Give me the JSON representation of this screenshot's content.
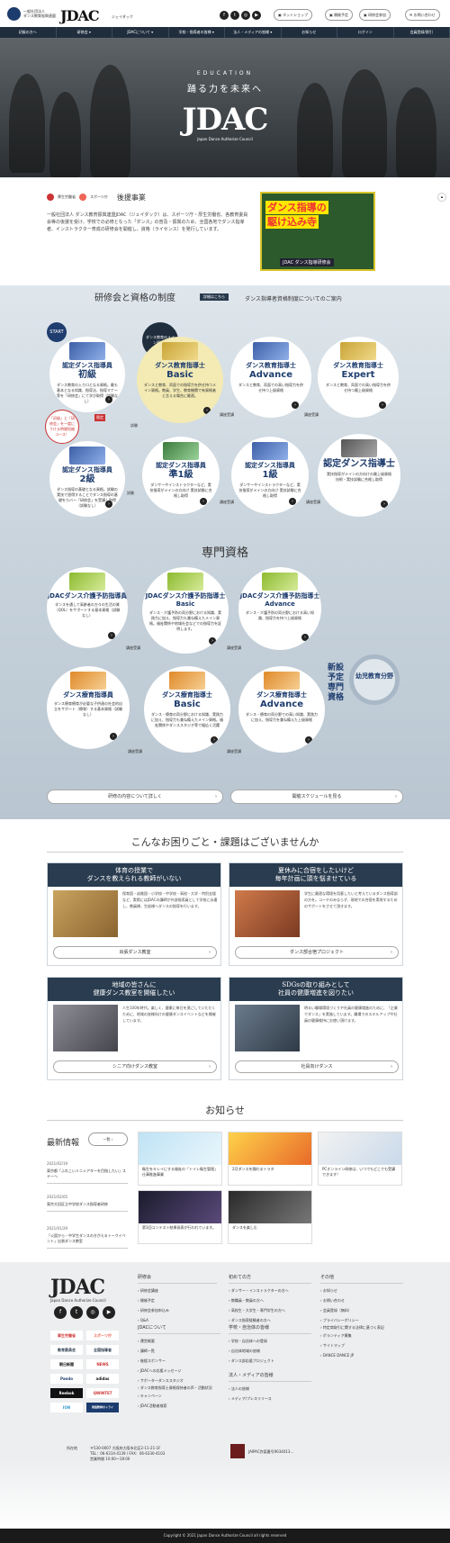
{
  "header": {
    "org_line1": "一般社団法人",
    "org_line2": "ダンス教育振興連盟",
    "logo": "JDAC",
    "logo_sub": "ジェイダック",
    "buttons": [
      "ネットショップ",
      "開催予定",
      "研修会参加",
      "お問い合わせ"
    ],
    "sns": [
      "facebook-icon",
      "twitter-icon",
      "instagram-icon",
      "youtube-icon"
    ]
  },
  "nav": [
    "初級の方へ",
    "研修会 ▾",
    "JDACについて ▾",
    "学校・指導者の皆様 ▾",
    "法人・メディアの皆様 ▾",
    "お知らせ",
    "ログイン",
    "会員登録/割引"
  ],
  "hero": {
    "edu": "EDUCATION",
    "catch": "踊る力を未来へ",
    "logo": "JDAC",
    "en": "Japan Dance Authorize Council"
  },
  "intro": {
    "sponsor1": "厚生労働省",
    "sponsor2": "スポーツ庁",
    "sponsor_label": "後援事業",
    "text": "一般社団法人 ダンス教育振興連盟JDAC（ジェイダック）は、スポーツ庁・厚生労働省、各教育委員会等の後援を受け、学校での必修となった「ダンス」の普及・振興のため、全国各地でダンス指導者、インストラクター育成の研修会を開催し、資格（ライセンス）を発行しています。",
    "banner_line1": "ダンス指導の",
    "banner_line2": "駆け込み寺",
    "banner_foot": "JDAC ダンス指導研修会"
  },
  "quals": {
    "title": "研修会と資格の制度",
    "chip": "詳細はこちら",
    "note": "ダンス指導者資格制度についてのご案内",
    "start": "START",
    "badge1": "ダンス教育のメイン資格！",
    "badge2": "「初級」と「研修会」を一度にうける時間短縮コース！",
    "badge2_tag": "限定",
    "step_label": "試験",
    "step_label2": "講座受講",
    "top_row": [
      {
        "name": "認定ダンス指導員",
        "level": "初級",
        "desc": "ダンス教育の入り口となる資格。最も基本となる知識、指導法、指導マナー等を「研修会」にて学び取得（試験なし）"
      },
      {
        "name": "ダンス教育指導士",
        "level": "Basic",
        "desc": "ダンスと教育、両面での指導力を併せ持つメイン資格。教員、学生、教育機関で有資格者と言える場合に最適。"
      },
      {
        "name": "ダンス教育指導士",
        "level": "Advance",
        "desc": "ダンスと教育、両面での高い指導力を併せ持つ上級資格"
      },
      {
        "name": "ダンス教育指導士",
        "level": "Expert",
        "desc": "ダンスと教育、両面での高い指導力を併せ持つ最上級資格"
      }
    ],
    "mid_row": [
      {
        "name": "認定ダンス指導員",
        "level": "2級",
        "desc": "ダンス指導の基礎となる資格。試験の実技で習得することでダンス指導の基礎をカバー「研修会」を受講し取得（試験なし）"
      },
      {
        "name": "認定ダンス指導員",
        "level": "準1級",
        "desc": "ダンサーやインストラクターなど、実技指導がメインの方向け 実技試験に合格し取得"
      },
      {
        "name": "認定ダンス指導員",
        "level": "1級",
        "desc": "ダンサーやインストラクターなど、実技指導がメインの方向け 実技試験に合格し取得"
      },
      {
        "name": "認定ダンス指導士",
        "level": "",
        "desc": "実技指導がメインの方向けの最上級資格 技術・実技試験に合格し取得"
      }
    ],
    "senmon_title": "専門資格",
    "spec_row1": [
      {
        "name": "JDACダンス介護予防指導員",
        "level": "",
        "desc": "ダンスを通して高齢者の方々の生活の質（QOL）をサポートする基本資格（試験なし）"
      },
      {
        "name": "JDACダンス介護予防指導士",
        "level": "Basic",
        "desc": "ダンス・介護予防の両分野における知識、実践力に加え、指導力も兼ね備えたメイン資格。福祉関係や地域社会などでの指導力を証明します。"
      },
      {
        "name": "JDACダンス介護予防指導士",
        "level": "Advance",
        "desc": "ダンス・介護予防の両分野における高い知識、指導力を持つ上級資格"
      }
    ],
    "spec_row2": [
      {
        "name": "ダンス療育指導員",
        "level": "",
        "desc": "ダンス療育療育が必要な子供達の社会的自立をサポート（療育）する基本資格（試験なし）"
      },
      {
        "name": "ダンス療育指導士",
        "level": "Basic",
        "desc": "ダンス・療育の両分野における知識、実践力に加え、指導力も兼ね備えたメイン資格。福祉関係やダンススタジオ等で幅広く活躍"
      },
      {
        "name": "ダンス療育指導士",
        "level": "Advance",
        "desc": "ダンス・療育の両分野での高い知識、実践力に加え、指導力を兼ね備えた上級資格"
      }
    ],
    "coming_soon": "新設予定専門資格",
    "yoji": "幼児教育分野",
    "btn_detail": "研修の内容について詳しく",
    "btn_schedule": "開催スケジュールを見る"
  },
  "problems": {
    "title": "こんなお困りごと・課題はございませんか",
    "cards": [
      {
        "h1": "体育の授業で",
        "h2": "ダンスを教えられる教師がいない",
        "text": "保育園・幼稚園・小学校・中学校・高校・大学・特別支援など、実際にはJDACの講師が外部指導員として学校に派遣し、教員様、生徒様へダンスの指導を行います。",
        "btn": "出張ダンス教室"
      },
      {
        "h1": "夏休みに合宿をしたいけど",
        "h2": "毎年計画に頭を悩ませている",
        "text": "学生に最適な環境を用意したいと考えているダンス指導部の方を。コーチのみならず、現地での合宿を実現するためのサポートをさせて頂きます。",
        "btn": "ダンス部合宿プロジェクト"
      },
      {
        "h1": "地域の皆さんに",
        "h2": "健康ダンス教室を開催したい",
        "text": "人生100年時代。楽しく、健康に毎日を過ごしていただくために、地域の皆様向けの健康ダンスイベントなどを開催しています。",
        "btn": "シニア向けダンス教室"
      },
      {
        "h1": "SDGsの取り組みとして",
        "h2": "社員の健康増進を図りたい",
        "text": "明るい職場環境づくりや社員の健康増進のために、「企業でダンス」を実施しています。職場でのスキルアップや社員の健康維持にお使い頂けます。",
        "btn": "社員向けダンス"
      }
    ]
  },
  "news": {
    "title": "お知らせ",
    "latest": "最新情報",
    "list_btn": "一覧",
    "items": [
      {
        "date": "2021/02/19",
        "text": "東京都「ふれこいミニシアターを目指したい」ステーへ"
      },
      {
        "date": "2021/02/05",
        "text": "東京大田区立中学校ダンス指導者研修"
      },
      {
        "date": "2021/01/29",
        "text": "「公園から・中学生ダンスのきがえるトークイベント」出張ダンス教室"
      }
    ],
    "cards": [
      {
        "text": "衛生をキレイにする福祉の「トイレ衛生管理」仕事推進事業"
      },
      {
        "text": "2月ダンスを踊れるトラタ"
      },
      {
        "text": "PCオンライン研修は、いつでもどこでも受講できます！"
      },
      {
        "text": "第1回コンテスト結果発表が行われています。"
      },
      {
        "text": "ダンスを楽しむ"
      }
    ]
  },
  "footer": {
    "logo": "JDAC",
    "tagline": "Japan Dance Authorize Council",
    "badges": [
      "厚生労働省",
      "スポーツ庁",
      "教育委員会",
      "全国指導者",
      "朝日新聞",
      "NEWS",
      "Pando",
      "adidas",
      "Reebok",
      "QWINTET",
      "ION",
      "家庭教師のトライ"
    ],
    "col1": {
      "h": "研修会",
      "items": [
        "研修会講座",
        "開催予定",
        "研修会参加申込み",
        "Q&A"
      ]
    },
    "col1b": {
      "h": "JDACについて",
      "items": [
        "運営概要",
        "講師一覧",
        "後援スポンサー",
        "JDACへの応援メッセージ",
        "サポーターダンススタジオ",
        "ダンス教育指導士資格保持者の声・活動状況",
        "キャンペーン",
        "JDAC活動者検索"
      ]
    },
    "col2": {
      "h": "初めての方",
      "items": [
        "ダンサー・インストラクターの方へ",
        "教職員・教員の方へ",
        "高校生・大学生・専門学生の方へ",
        "ダンス指導経験者の方へ"
      ]
    },
    "col2b": {
      "h": "学校・自治体の皆様",
      "items": [
        "学校・自治体への登録",
        "自治体地域の皆様",
        "ダンス部応援プロジェクト"
      ]
    },
    "col2c": {
      "h": "法人・メディアの皆様",
      "items": [
        "法人の皆様",
        "メディア/プレスリリース"
      ]
    },
    "col3": {
      "h": "その他",
      "items": [
        "お知らせ",
        "お問い合わせ",
        "会員登録（無料）",
        "プライバシーポリシー",
        "特定商取引に関する法律に基づく表記",
        "ボランティア募集",
        "サイトマップ",
        "DANCE DANCE JP"
      ]
    },
    "address_label": "所在地",
    "address": "〒530-0007 大阪府大阪市北区2-11-21-1F",
    "tel": "TEL：06-6314-4139 / FAX：06-6330-4103",
    "hours": "営業時間 10:00〜18:00",
    "reg": "JAIPAC許諾番号9034013...",
    "copyright": "Copyright © 2021 Japan Dance Authorize Council all rights reserved"
  }
}
